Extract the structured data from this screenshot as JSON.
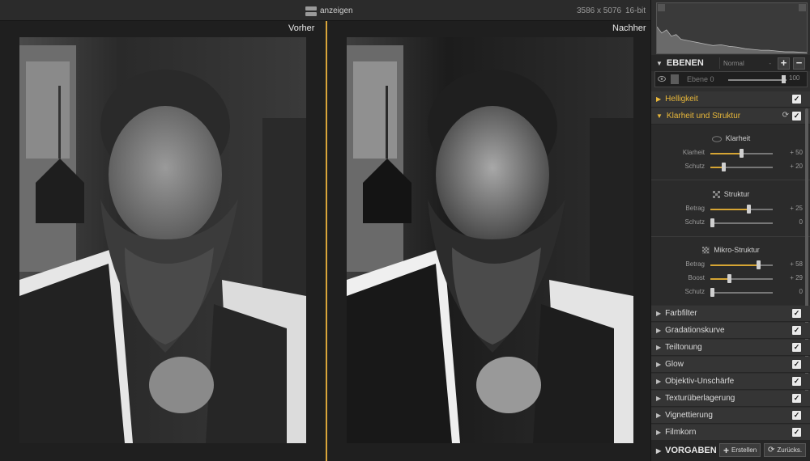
{
  "topbar": {
    "show_label": "anzeigen",
    "dimensions": "3586 x 5076",
    "bit_depth": "16-bit"
  },
  "preview": {
    "before_label": "Vorher",
    "after_label": "Nachher"
  },
  "layers": {
    "title": "EBENEN",
    "blend_mode": "Normal",
    "blend_dash": "-",
    "add_icon": "+",
    "remove_icon": "−",
    "layer_name": "Ebene 0",
    "layer_opacity": "100"
  },
  "filters": {
    "brightness": "Helligkeit",
    "clarity_structure": "Klarheit und Struktur",
    "color_filter": "Farbfilter",
    "gradation_curve": "Gradationskurve",
    "split_toning": "Teiltonung",
    "glow": "Glow",
    "lens_blur": "Objektiv-Unschärfe",
    "texture_overlay": "Texturüberlagerung",
    "vignetting": "Vignettierung",
    "film_grain": "Filmkorn"
  },
  "clarity": {
    "title": "Klarheit",
    "sliders": [
      {
        "label": "Klarheit",
        "value": "+ 50",
        "fraction": 0.5
      },
      {
        "label": "Schutz",
        "value": "+ 20",
        "fraction": 0.2
      }
    ]
  },
  "structure": {
    "title": "Struktur",
    "sliders": [
      {
        "label": "Betrag",
        "value": "+ 25",
        "fraction": 0.625
      },
      {
        "label": "Schutz",
        "value": "0",
        "fraction": 0.0
      }
    ]
  },
  "micro_structure": {
    "title": "Mikro-Struktur",
    "sliders": [
      {
        "label": "Betrag",
        "value": "+ 58",
        "fraction": 0.79
      },
      {
        "label": "Boost",
        "value": "+ 29",
        "fraction": 0.29
      },
      {
        "label": "Schutz",
        "value": "0",
        "fraction": 0.0
      }
    ]
  },
  "presets": {
    "title": "VORGABEN",
    "create_label": "Erstellen",
    "reset_label": "Zurücks."
  },
  "icons": {
    "eye": "eye-icon",
    "check": "✓",
    "triangle_down": "▼",
    "triangle_right": "▶",
    "refresh": "⟳"
  },
  "colors": {
    "accent": "#e9b83a",
    "divider": "#d9a53a"
  }
}
